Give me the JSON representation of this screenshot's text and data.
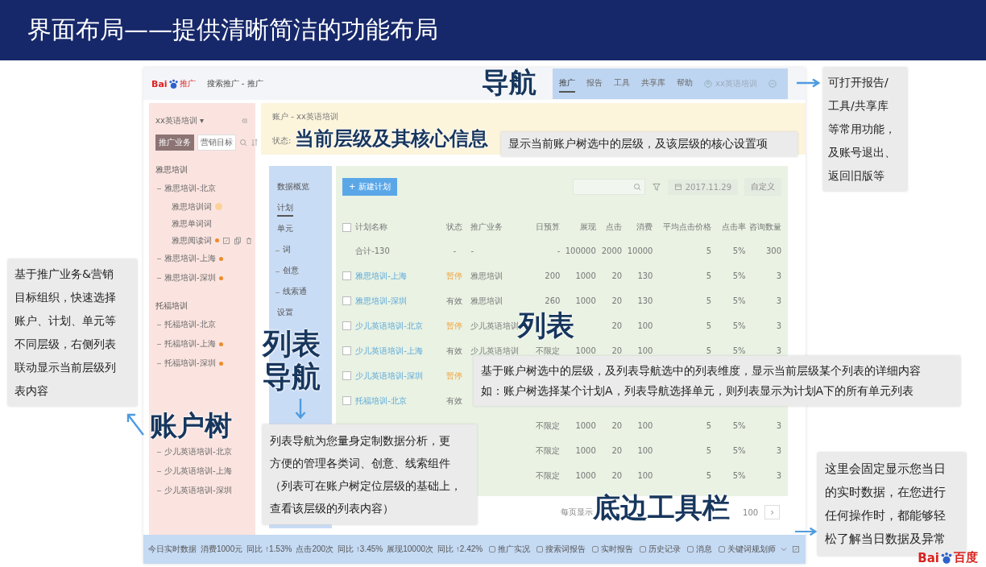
{
  "title": "界面布局——提供清晰简洁的功能布局",
  "app": {
    "logo": {
      "prefix": "Bai",
      "suffix": "推广"
    },
    "breadcrumb": "搜索推广 - 推广",
    "nav_tabs": [
      {
        "label": "推广",
        "selected": true
      },
      {
        "label": "报告",
        "selected": false
      },
      {
        "label": "工具",
        "selected": false
      },
      {
        "label": "共享库",
        "selected": false
      },
      {
        "label": "帮助",
        "selected": false
      }
    ],
    "account": "xx英语培训",
    "sidebar": {
      "account": "xx英语培训 ▾",
      "tabs": [
        {
          "label": "推广业务",
          "selected": true
        },
        {
          "label": "营销目标",
          "selected": false
        }
      ],
      "groups": [
        {
          "label": "雅思培训",
          "items": [
            {
              "label": "雅思培训-北京",
              "flag": false,
              "children": [
                {
                  "label": "雅思培训词",
                  "warning": true,
                  "actions": false
                },
                {
                  "label": "雅思单词词",
                  "warning": false,
                  "actions": false
                },
                {
                  "label": "雅思阅读词",
                  "warning": false,
                  "actions": true
                }
              ]
            },
            {
              "label": "雅思培训-上海",
              "flag": true
            },
            {
              "label": "雅思培训-深圳",
              "flag": true
            }
          ]
        },
        {
          "label": "托福培训",
          "items": [
            {
              "label": "托福培训-北京",
              "flag": false
            },
            {
              "label": "托福培训-上海",
              "flag": true
            },
            {
              "label": "托福培训-深圳",
              "flag": true
            }
          ]
        },
        {
          "items": [
            {
              "label": "少儿英语培训-北京",
              "flag": false
            },
            {
              "label": "少儿英语培训-上海",
              "flag": false
            },
            {
              "label": "少儿英语培训-深圳",
              "flag": false
            }
          ]
        }
      ]
    },
    "header": {
      "path": "账户 - xx英语培训",
      "status_label": "状态:"
    },
    "list_nav": [
      {
        "label": "数据概览",
        "selected": false,
        "expandable": false
      },
      {
        "label": "计划",
        "selected": true,
        "expandable": false
      },
      {
        "label": "单元",
        "selected": false,
        "expandable": false
      },
      {
        "label": "词",
        "selected": false,
        "expandable": true
      },
      {
        "label": "创意",
        "selected": false,
        "expandable": true
      },
      {
        "label": "线索通",
        "selected": false,
        "expandable": true
      },
      {
        "label": "设置",
        "selected": false,
        "expandable": false
      }
    ],
    "toolbar": {
      "new_button": "+ 新建计划",
      "date": "2017.11.29",
      "custom_button": "自定义"
    },
    "table": {
      "columns": [
        "计划名称",
        "状态",
        "推广业务",
        "日预算",
        "展现",
        "点击",
        "消费",
        "平均点击价格",
        "点击率",
        "咨询数量"
      ],
      "header_checked": false,
      "rows": [
        {
          "kind": "total",
          "cells": [
            "合计-130",
            "-",
            "-",
            "-",
            "100000",
            "2000",
            "10000",
            "5",
            "5%",
            "300"
          ]
        },
        {
          "kind": "item",
          "checked": false,
          "paused": true,
          "cells": [
            "雅思培训-上海",
            "暂停",
            "雅思培训",
            "200",
            "1000",
            "20",
            "130",
            "5",
            "5%",
            "3"
          ]
        },
        {
          "kind": "item",
          "checked": false,
          "paused": false,
          "cells": [
            "雅思培训-深圳",
            "有效",
            "雅思培训",
            "260",
            "1000",
            "20",
            "130",
            "5",
            "5%",
            "3"
          ]
        },
        {
          "kind": "item",
          "checked": false,
          "paused": true,
          "cells": [
            "少儿英语培训-北京",
            "暂停",
            "少儿英语培训",
            null,
            null,
            "20",
            "100",
            "5",
            "5%",
            "3"
          ]
        },
        {
          "kind": "item",
          "checked": false,
          "paused": false,
          "cells": [
            "少儿英语培训-上海",
            "有效",
            "少儿英语培训",
            "不限定",
            "1000",
            "20",
            "100",
            "5",
            "5%",
            "3"
          ]
        },
        {
          "kind": "item",
          "checked": false,
          "paused": true,
          "cells": [
            "少儿英语培训-深圳",
            "暂停",
            null,
            null,
            null,
            null,
            null,
            null,
            null,
            null
          ]
        },
        {
          "kind": "item",
          "checked": false,
          "paused": false,
          "cells": [
            "托福培训-北京",
            "有效",
            null,
            null,
            null,
            null,
            null,
            null,
            null,
            null
          ]
        },
        {
          "kind": "covered",
          "cells": [
            null,
            null,
            null,
            "不限定",
            "1000",
            "20",
            "100",
            "5",
            "5%",
            "3"
          ]
        },
        {
          "kind": "covered",
          "cells": [
            null,
            null,
            null,
            "不限定",
            "1000",
            "20",
            "100",
            "5",
            "5%",
            "3"
          ]
        },
        {
          "kind": "covered",
          "cells": [
            null,
            null,
            null,
            "不限定",
            "1000",
            "20",
            "100",
            "5",
            "5%",
            "3"
          ]
        }
      ]
    },
    "pager": {
      "label": "每页显示",
      "size": "100",
      "next": "›"
    },
    "bottom_bar": [
      {
        "kind": "title",
        "text": "今日实时数据"
      },
      {
        "kind": "stat",
        "text": "消费1000元"
      },
      {
        "kind": "stat",
        "text": "同比 ↑1.53%"
      },
      {
        "kind": "stat",
        "text": "点击200次"
      },
      {
        "kind": "stat",
        "text": "同比 ↑3.45%"
      },
      {
        "kind": "stat",
        "text": "展现10000次"
      },
      {
        "kind": "stat",
        "text": "同比 ↑2.42%"
      },
      {
        "kind": "tool",
        "text": "推广实况"
      },
      {
        "kind": "tool",
        "text": "搜索词报告"
      },
      {
        "kind": "tool",
        "text": "实时报告"
      },
      {
        "kind": "tool",
        "text": "历史记录"
      },
      {
        "kind": "tool",
        "text": "消息"
      },
      {
        "kind": "tool",
        "text": "关键词规划师"
      }
    ]
  },
  "callouts": [
    {
      "kind": "label",
      "lines": [
        "导航"
      ]
    },
    {
      "kind": "note",
      "lines": [
        "可打开报告/",
        "工具/共享库",
        "等常用功能，",
        "及账号退出、",
        "返回旧版等"
      ]
    },
    {
      "kind": "label",
      "lines": [
        "当前层级及其核心信息"
      ]
    },
    {
      "kind": "note",
      "lines": [
        "显示当前账户树选中的层级，及该层级的核心设置项"
      ]
    },
    {
      "kind": "note",
      "lines": [
        "基于推广业务&营销",
        "目标组织，快速选择",
        "账户、计划、单元等",
        "不同层级，右侧列表",
        "联动显示当前层级列",
        "表内容"
      ]
    },
    {
      "kind": "label",
      "lines": [
        "账户树"
      ]
    },
    {
      "kind": "label",
      "lines": [
        "列表",
        "导航"
      ]
    },
    {
      "kind": "label",
      "lines": [
        "列表"
      ]
    },
    {
      "kind": "note",
      "lines": [
        "基于账户树选中的层级，及列表导航选中的列表维度，显示当前层级某个列表的详细内容",
        "如：账户树选择某个计划A，列表导航选择单元，则列表显示为计划A下的所有单元列表"
      ]
    },
    {
      "kind": "note",
      "lines": [
        "列表导航为您量身定制数据分析，更",
        "方便的管理各类词、创意、线索组件",
        "（列表可在账户树定位层级的基础上，",
        "查看该层级的列表内容）"
      ]
    },
    {
      "kind": "label",
      "lines": [
        "底边工具栏"
      ]
    },
    {
      "kind": "note",
      "lines": [
        "这里会固定显示您当日",
        "的实时数据，在您进行",
        "任何操作时，都能够轻",
        "松了解当日数据及异常"
      ]
    }
  ],
  "slide_logo": {
    "prefix": "Bai",
    "suffix": "百度"
  }
}
